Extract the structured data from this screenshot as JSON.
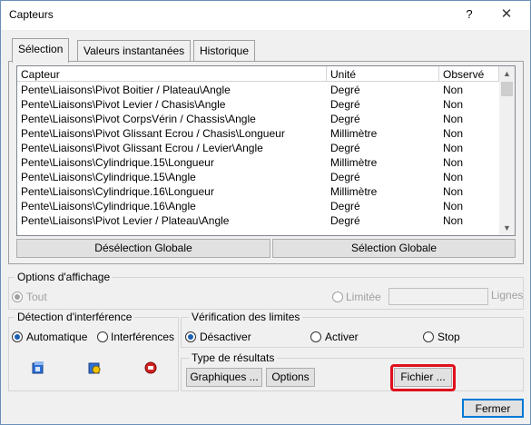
{
  "window": {
    "title": "Capteurs",
    "help_glyph": "?",
    "close_glyph": "✕"
  },
  "tabs": [
    {
      "label": "Sélection"
    },
    {
      "label": "Valeurs instantanées"
    },
    {
      "label": "Historique"
    }
  ],
  "table": {
    "headers": [
      "Capteur",
      "Unité",
      "Observé"
    ],
    "rows": [
      [
        "Pente\\Liaisons\\Pivot Boitier / Plateau\\Angle",
        "Degré",
        "Non"
      ],
      [
        "Pente\\Liaisons\\Pivot Levier / Chasis\\Angle",
        "Degré",
        "Non"
      ],
      [
        "Pente\\Liaisons\\Pivot CorpsVérin / Chassis\\Angle",
        "Degré",
        "Non"
      ],
      [
        "Pente\\Liaisons\\Pivot Glissant Ecrou / Chasis\\Longueur",
        "Millimètre",
        "Non"
      ],
      [
        "Pente\\Liaisons\\Pivot Glissant Ecrou / Levier\\Angle",
        "Degré",
        "Non"
      ],
      [
        "Pente\\Liaisons\\Cylindrique.15\\Longueur",
        "Millimètre",
        "Non"
      ],
      [
        "Pente\\Liaisons\\Cylindrique.15\\Angle",
        "Degré",
        "Non"
      ],
      [
        "Pente\\Liaisons\\Cylindrique.16\\Longueur",
        "Millimètre",
        "Non"
      ],
      [
        "Pente\\Liaisons\\Cylindrique.16\\Angle",
        "Degré",
        "Non"
      ],
      [
        "Pente\\Liaisons\\Pivot Levier / Plateau\\Angle",
        "Degré",
        "Non"
      ]
    ]
  },
  "buttons": {
    "deselect_all": "Désélection Globale",
    "select_all": "Sélection Globale",
    "graphiques": "Graphiques ...",
    "options": "Options",
    "fichier": "Fichier ...",
    "fermer": "Fermer"
  },
  "display_options": {
    "title": "Options d'affichage",
    "all_label": "Tout",
    "limited_label": "Limitée",
    "lines_label": "Lignes",
    "limited_value": ""
  },
  "interference": {
    "title": "Détection d'interférence",
    "auto_label": "Automatique",
    "interf_label": "Interférences"
  },
  "limits": {
    "title": "Vérification des limites",
    "off_label": "Désactiver",
    "on_label": "Activer",
    "stop_label": "Stop"
  },
  "results": {
    "title": "Type de résultats"
  },
  "colors": {
    "highlight": "#e0101c",
    "radio_selected": "#1a5fb4"
  }
}
